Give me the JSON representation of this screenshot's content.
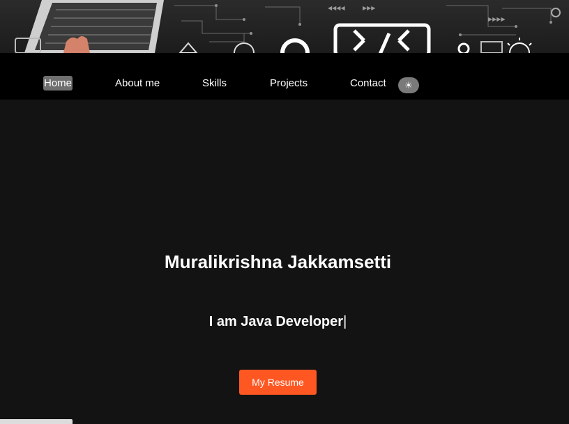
{
  "colors": {
    "page_bg": "#131313",
    "navbar_bg": "#000000",
    "active_nav_bg": "#6f6f6f",
    "toggle_bg": "#7a7a7a",
    "accent": "#ff5722",
    "text": "#ffffff"
  },
  "nav": {
    "items": [
      {
        "label": "Home",
        "active": true
      },
      {
        "label": "About me",
        "active": false
      },
      {
        "label": "Skills",
        "active": false
      },
      {
        "label": "Projects",
        "active": false
      },
      {
        "label": "Contact",
        "active": false
      }
    ],
    "theme_toggle_icon": "☀"
  },
  "hero": {
    "name": "Muralikrishna Jakkamsetti",
    "role_text": "I am Java Developer",
    "cursor": "|",
    "resume_label": "My Resume"
  },
  "icons": {
    "banner": [
      "laptop-icon",
      "code-brackets-icon",
      "gear-icon",
      "lightbulb-icon",
      "circuit-pattern"
    ],
    "theme_toggle": "sun-icon"
  }
}
